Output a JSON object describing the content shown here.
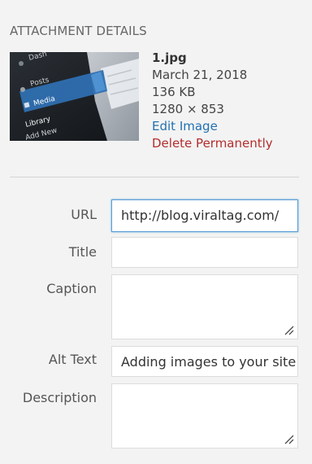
{
  "header": {
    "title": "ATTACHMENT DETAILS"
  },
  "thumbnail": {
    "menu_items": [
      "Dash",
      "Posts",
      "Media",
      "Library",
      "Add New"
    ],
    "accent_color": "#2271b1"
  },
  "file": {
    "name": "1.jpg",
    "date": "March 21, 2018",
    "size": "136 KB",
    "dimensions": "1280 × 853",
    "edit_label": "Edit Image",
    "delete_label": "Delete Permanently"
  },
  "form": {
    "url": {
      "label": "URL",
      "value": "http://blog.viraltag.com/"
    },
    "title": {
      "label": "Title",
      "value": ""
    },
    "caption": {
      "label": "Caption",
      "value": ""
    },
    "alt_text": {
      "label": "Alt Text",
      "value": "Adding images to your site"
    },
    "description": {
      "label": "Description",
      "value": ""
    }
  },
  "colors": {
    "link": "#2271b1",
    "delete": "#b32d2e",
    "focus_border": "#5b9dd9"
  }
}
